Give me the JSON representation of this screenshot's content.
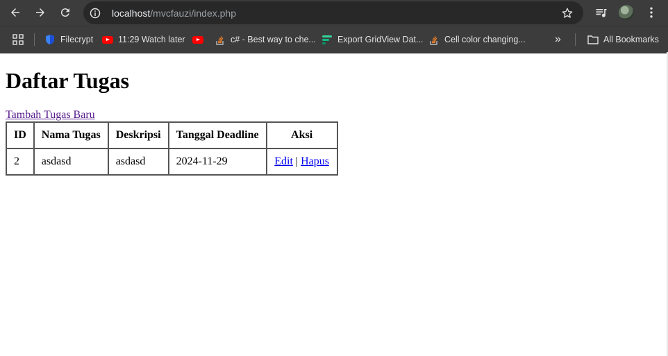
{
  "browser": {
    "url_host": "localhost",
    "url_path": "/mvcfauzi/index.php",
    "bookmarks": [
      {
        "label": "Filecrypt",
        "icon": "shield-icon"
      },
      {
        "label": "11:29 Watch later",
        "icon": "youtube-icon"
      },
      {
        "label": "",
        "icon": "youtube-icon"
      },
      {
        "label": "c# - Best way to che...",
        "icon": "stackoverflow-icon"
      },
      {
        "label": "Export GridView Dat...",
        "icon": "bars-icon"
      },
      {
        "label": "Cell color changing...",
        "icon": "stackoverflow-icon"
      }
    ],
    "overflow_label": "»",
    "all_bookmarks": "All Bookmarks"
  },
  "page": {
    "title": "Daftar Tugas",
    "add_link": "Tambah Tugas Baru",
    "table": {
      "headers": [
        "ID",
        "Nama Tugas",
        "Deskripsi",
        "Tanggal Deadline",
        "Aksi"
      ],
      "rows": [
        {
          "id": "2",
          "nama": "asdasd",
          "deskripsi": "asdasd",
          "deadline": "2024-11-29",
          "edit": "Edit",
          "sep": "|",
          "hapus": "Hapus"
        }
      ]
    }
  },
  "colors": {
    "chrome_bg": "#3c3c3c",
    "omnibox_bg": "#282828",
    "visited_link": "#551a8b",
    "link": "#0000ee"
  }
}
